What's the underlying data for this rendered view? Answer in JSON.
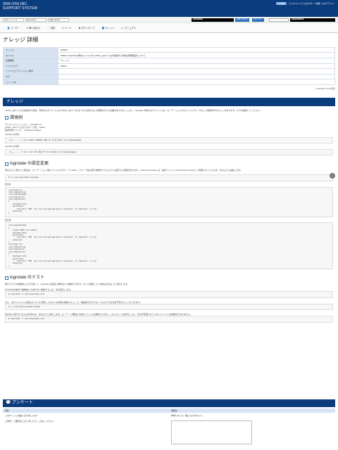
{
  "header": {
    "logo_line1": "SRA OSS,INC.",
    "logo_line2": "SUPPORT SYSTEM",
    "top_badge": "日本語",
    "top_text": "ビジネスシステムのサポート情報（ログアウト）"
  },
  "userbar": {
    "favorites": [
      "サポートトップ",
      "問い合わせ",
      "お問い合わせ"
    ],
    "black_label": "■■■■■■■■■",
    "blue_a": "お問い合わせ",
    "blue_b": "ログアウト",
    "right_black": "■■■■■■■■■■■"
  },
  "nav": {
    "items": [
      "ユーザー",
      "問い合わせ",
      "資料",
      "メール",
      "ダウンロード",
      "ナレッジ",
      "マニュアル"
    ]
  },
  "page": {
    "title": "ナレッジ 詳細",
    "info": [
      {
        "k": "ナレッジ",
        "v": "000053"
      },
      {
        "k": "タイトル",
        "v": "Zabbix: logrotate 対象のファイルを zabbix_agent でログ監視する場合の権限設定について"
      },
      {
        "k": "記事種別",
        "v": "ナレッジ"
      },
      {
        "k": "ソフトウェア",
        "v": "Zabbix"
      },
      {
        "k": "ソフトウェアバージョン番号",
        "v": ""
      },
      {
        "k": "タグ",
        "v": ""
      },
      {
        "k": "リソースID",
        "v": ""
      }
    ],
    "updated": "2015/6/1 15:48 更新"
  },
  "knowledge": {
    "heading": "ナレッジ",
    "intro": "zabbix_agent でログ監視する場合、所有のログファイルは zabbix_agent プロセスから読めるよう権限を付ける必要があります。しかし、logrotate 対象のログファイルは、ローテーションのタイミングで、付与した権限が外れることがあります。以下を確認してください。",
    "env_title": "環境例",
    "env_lines": [
      "ディストリビューション：CentOS 6.5",
      "zabbix_agent プロセスのユーザ名：zabbix",
      "監視対象ファイル：/var/log/messages"
    ],
    "label_before": "logrotate 実行前",
    "code_before": "-rw-r-----. 1 root zabbix 999999 10月 27 14:16 2012 /var/log/messages",
    "label_after": "logrotate 実行後",
    "code_after": "-rw-------. 1 root root 146 10月 27 14:21 2012 /var/log/messages",
    "logrotate_title": "logrotate の設定変更",
    "logrotate_desc": "例のように変化した場合は、ローテーション後もファイルのグループ zabbix、グループ読み取り権限がつけるように設定する必要があります。/var/log/messages は、設定ファイル /etc/logrotate.d/syslog で管理されているため、次のように編集します。",
    "code_cmd": "# vi /etc/logrotate.d/syslog",
    "label_edit_before": "修正前",
    "code_edit_before": "/var/log/cron\n/var/log/maillog\n/var/log/messages\n/var/log/secure\n/var/log/spooler\n{\n    sharedscripts\n    postrotate\n        /bin/kill -HUP `cat /var/run/syslogd.pid 2> /dev/null` 2> /dev/null || true\n    endscript\n}",
    "label_edit_after": "修正後",
    "code_edit_after": "/var/log/messages\n{\n    create 0640 root zabbix\n    sharedscripts\n    postrotate\n        /bin/kill -HUP `cat /var/run/syslogd.pid 2> /dev/null` 2> /dev/null || true\n    endscript\n}\n/var/log/cron\n/var/log/maillog\n/var/log/secure\n/var/log/spooler\n{\n    sharedscripts\n    postrotate\n        /bin/kill -HUP `cat /var/run/syslogd.pid 2> /dev/null` 2> /dev/null || true\n    endscript\n}",
    "test_title": "logrotate のテスト",
    "test_desc1": "時以下に示す強制的にログ分割して、logrotate の設定に問題ないか確認できます。すぐに確認したい場合は次のように実行します。",
    "test_desc2": "まずは次の操作で強制的に分割せずに確認するには、次を実行します。",
    "code_test1": "# logrotate -d /etc/logrotate.conf",
    "test_desc3": "また、次のファイルに記録されている日時とプロセスの状態を確認することで、強制実行を行わなくてもログの分割を予測することができます。",
    "code_test2": "# vi /var/lib/logrotate.status",
    "test_desc4": "本日中に実行すべきものがあれば、次のように実行します。ローテート期間より前のファイルは保持されます。このコマンドを実行しても、日付が変更されていないファイルの処理は行われません。",
    "code_test3": "# logrotate -f /etc/logrotate.conf"
  },
  "survey": {
    "heading": "アンケート",
    "col_q": "質問",
    "col_a": "選択肢",
    "q1": "このナレッジは役に立ちましたか？",
    "a1": "参考になった / 役に立たなかった",
    "q2": "ご意見・ご要望がございましたら、ご記入ください。"
  }
}
